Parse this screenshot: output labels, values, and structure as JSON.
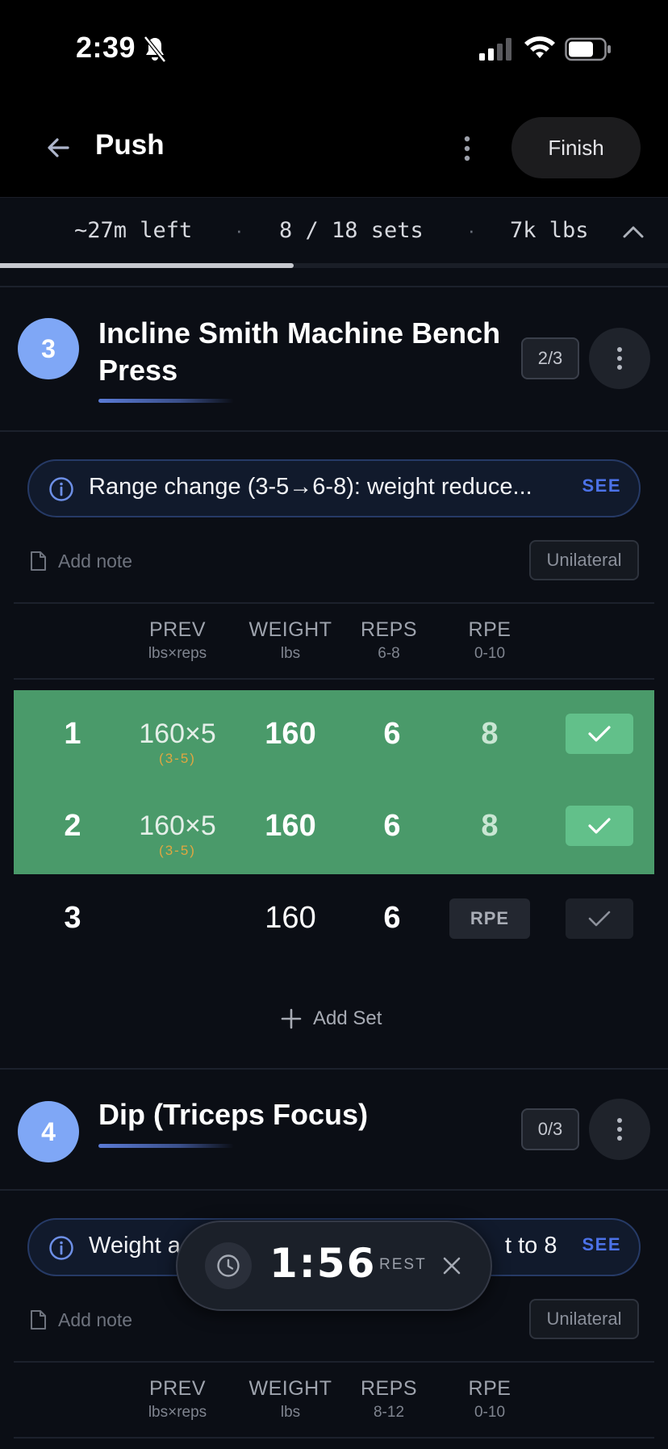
{
  "status_bar": {
    "time": "2:39"
  },
  "header": {
    "title": "Push",
    "finish_label": "Finish"
  },
  "summary": {
    "time_left": "~27m left",
    "sets": "8 / 18 sets",
    "volume": "7k lbs",
    "separator": "·",
    "progress": 0.44
  },
  "exercises": [
    {
      "number": "3",
      "title": "Incline Smith Machine Bench Press",
      "sets_badge": "2/3",
      "info": {
        "text": "Range change (3-5→6-8): weight reduce...",
        "action": "SEE"
      },
      "note_label": "Add note",
      "unilateral_label": "Unilateral",
      "columns": [
        {
          "label": "PREV",
          "sub": "lbs×reps"
        },
        {
          "label": "WEIGHT",
          "sub": "lbs"
        },
        {
          "label": "REPS",
          "sub": "6-8"
        },
        {
          "label": "RPE",
          "sub": "0-10"
        }
      ],
      "sets": [
        {
          "set": "1",
          "prev": "160×5",
          "prev_range": "(3-5)",
          "weight": "160",
          "reps": "6",
          "rpe": "8",
          "completed": true
        },
        {
          "set": "2",
          "prev": "160×5",
          "prev_range": "(3-5)",
          "weight": "160",
          "reps": "6",
          "rpe": "8",
          "completed": true
        },
        {
          "set": "3",
          "prev": "",
          "prev_range": "",
          "weight": "160",
          "reps": "6",
          "rpe": "RPE",
          "completed": false
        }
      ],
      "add_set_label": "Add Set"
    },
    {
      "number": "4",
      "title": "Dip (Triceps Focus)",
      "sets_badge": "0/3",
      "info": {
        "text_left": "Weight a",
        "text_right": "t to 8",
        "action": "SEE"
      },
      "note_label": "Add note",
      "unilateral_label": "Unilateral",
      "columns": [
        {
          "label": "PREV",
          "sub": "lbs×reps"
        },
        {
          "label": "WEIGHT",
          "sub": "lbs"
        },
        {
          "label": "REPS",
          "sub": "8-12"
        },
        {
          "label": "RPE",
          "sub": "0-10"
        }
      ]
    }
  ],
  "rest_timer": {
    "value": "1:56",
    "label": "REST"
  },
  "colors": {
    "accent": "#7fa7f6",
    "completed_row": "#4a9a6a",
    "check": "#62c08a",
    "link": "#4c72e8",
    "range": "#e0a640"
  }
}
